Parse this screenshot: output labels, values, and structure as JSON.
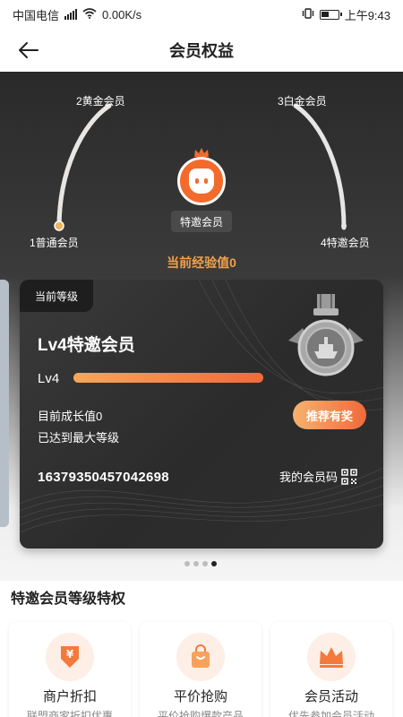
{
  "status_bar": {
    "carrier": "中国电信",
    "network": "4G",
    "speed": "0.00K/s",
    "time": "上午9:43"
  },
  "header": {
    "title": "会员权益",
    "back_icon": "arrow-left-icon"
  },
  "levels": {
    "items": [
      "1普通会员",
      "2黄金会员",
      "3白金会员",
      "4特邀会员"
    ],
    "current_badge": "特邀会员",
    "exp_text": "当前经验值0"
  },
  "card": {
    "tag": "当前等级",
    "title": "Lv4特邀会员",
    "level_short": "Lv4",
    "progress": 1.0,
    "growth_text": "目前成长值0",
    "max_text": "已达到最大等级",
    "recommend_label": "推荐有奖",
    "member_number": "1637935045704269‍8",
    "member_code_label": "我的会员码"
  },
  "carousel": {
    "total": 4,
    "active_index": 3
  },
  "privileges": {
    "title": "特邀会员等级特权",
    "items": [
      {
        "label": "商户折扣",
        "desc": "联盟商家折扣优惠",
        "icon": "discount-icon"
      },
      {
        "label": "平价抢购",
        "desc": "平价抢购爆款产品",
        "icon": "shopping-bag-icon"
      },
      {
        "label": "会员活动",
        "desc": "优先参加会员活动",
        "icon": "crown-icon"
      }
    ]
  },
  "colors": {
    "accent": "#f06a3a",
    "gold_text": "#f0a24a",
    "card_bg": "#2b2b2b"
  }
}
